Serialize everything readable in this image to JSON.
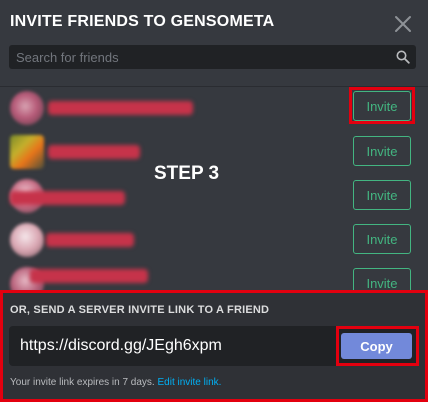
{
  "dialog": {
    "title": "INVITE FRIENDS TO GENSOMETA"
  },
  "search": {
    "placeholder": "Search for friends",
    "value": ""
  },
  "overlay": {
    "step_label": "STEP 3"
  },
  "friends": [
    {
      "invite_label": "Invite",
      "highlighted": true
    },
    {
      "invite_label": "Invite"
    },
    {
      "invite_label": "Invite"
    },
    {
      "invite_label": "Invite"
    },
    {
      "invite_label": "Invite"
    }
  ],
  "footer": {
    "title": "OR, SEND A SERVER INVITE LINK TO A FRIEND",
    "invite_link": "https://discord.gg/JEgh6xpm",
    "copy_label": "Copy",
    "expire_text": "Your invite link expires in 7 days.",
    "edit_link_label": "Edit invite link."
  },
  "colors": {
    "background": "#36393f",
    "footer_background": "#2f3136",
    "invite_green": "#43b581",
    "copy_button": "#7289da",
    "annotation_red": "#e3000f",
    "link_blue": "#00b0f4"
  },
  "icons": {
    "close": "close-icon",
    "search": "search-icon"
  }
}
